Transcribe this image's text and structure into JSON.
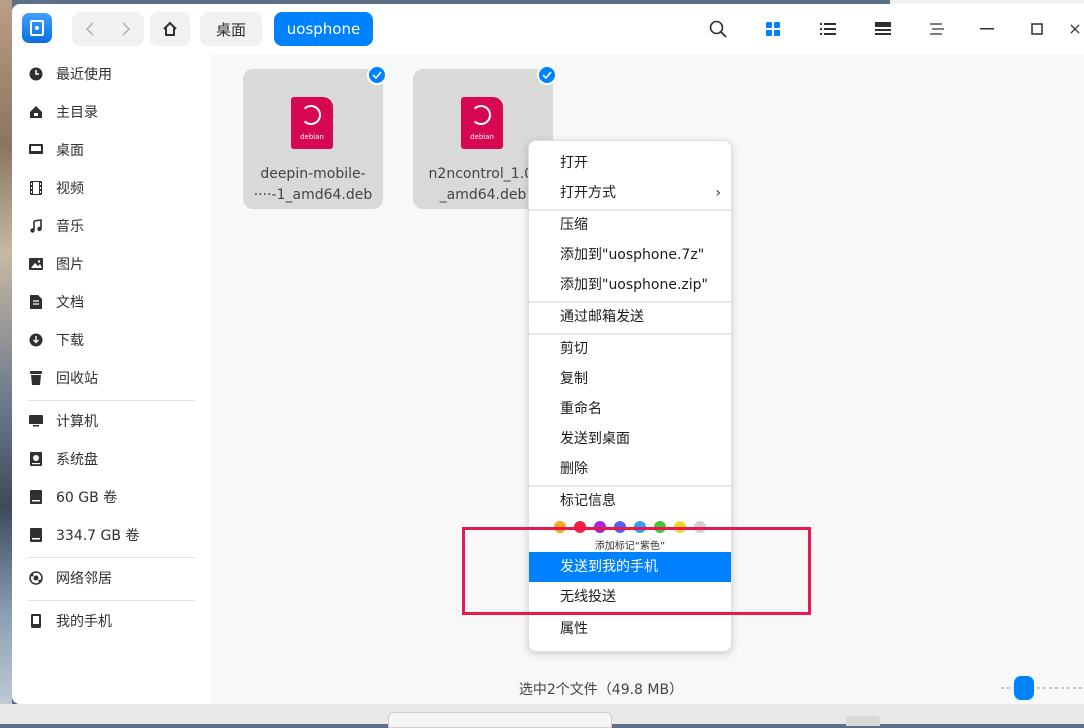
{
  "window": {
    "app_icon": "file-manager-icon",
    "breadcrumbs": [
      "桌面",
      "uosphone"
    ],
    "toolbar_icons": [
      "search-icon",
      "icon-view-icon",
      "list-view-icon",
      "detail-view-icon",
      "menu-icon",
      "minimize-icon",
      "maximize-icon",
      "close-icon"
    ]
  },
  "sidebar": {
    "items": [
      {
        "label": "最近使用",
        "icon": "recent-icon"
      },
      {
        "label": "主目录",
        "icon": "home-icon"
      },
      {
        "label": "桌面",
        "icon": "desktop-icon"
      },
      {
        "label": "视频",
        "icon": "video-icon"
      },
      {
        "label": "音乐",
        "icon": "music-icon"
      },
      {
        "label": "图片",
        "icon": "picture-icon"
      },
      {
        "label": "文档",
        "icon": "document-icon"
      },
      {
        "label": "下载",
        "icon": "download-icon"
      },
      {
        "label": "回收站",
        "icon": "trash-icon"
      },
      {
        "label": "计算机",
        "icon": "computer-icon"
      },
      {
        "label": "系统盘",
        "icon": "system-disk-icon"
      },
      {
        "label": "60 GB 卷",
        "icon": "disk-icon"
      },
      {
        "label": "334.7 GB 卷",
        "icon": "disk-icon"
      },
      {
        "label": "网络邻居",
        "icon": "network-icon"
      },
      {
        "label": "我的手机",
        "icon": "phone-icon"
      }
    ]
  },
  "files": [
    {
      "name_line1": "deepin-mobile-",
      "name_line2": "····-1_amd64.deb",
      "badge": "debian",
      "selected": true
    },
    {
      "name_line1": "n2ncontrol_1.0.",
      "name_line2": "_amd64.deb",
      "badge": "debian",
      "selected": true
    }
  ],
  "status_bar": {
    "text": "选中2个文件（49.8 MB）"
  },
  "context_menu": {
    "items": {
      "open": "打开",
      "open_with": "打开方式",
      "compress": "压缩",
      "add_7z": "添加到\"uosphone.7z\"",
      "add_zip": "添加到\"uosphone.zip\"",
      "send_mail": "通过邮箱发送",
      "cut": "剪切",
      "copy": "复制",
      "rename": "重命名",
      "send_desktop": "发送到桌面",
      "delete": "删除",
      "tag_info": "标记信息",
      "tag_hint": "添加标记“紫色”",
      "send_phone": "发送到我的手机",
      "wireless_cast": "无线投送",
      "properties": "属性"
    },
    "tag_colors": [
      "#f5a623",
      "#f5223a",
      "#a427d8",
      "#4c63f5",
      "#2ca0f5",
      "#43c43a",
      "#f5d623",
      "#cfcfcf"
    ],
    "active_item": "send_phone"
  },
  "colors": {
    "accent": "#0081ff",
    "highlight_box": "#e8194f",
    "debian": "#d70751"
  }
}
